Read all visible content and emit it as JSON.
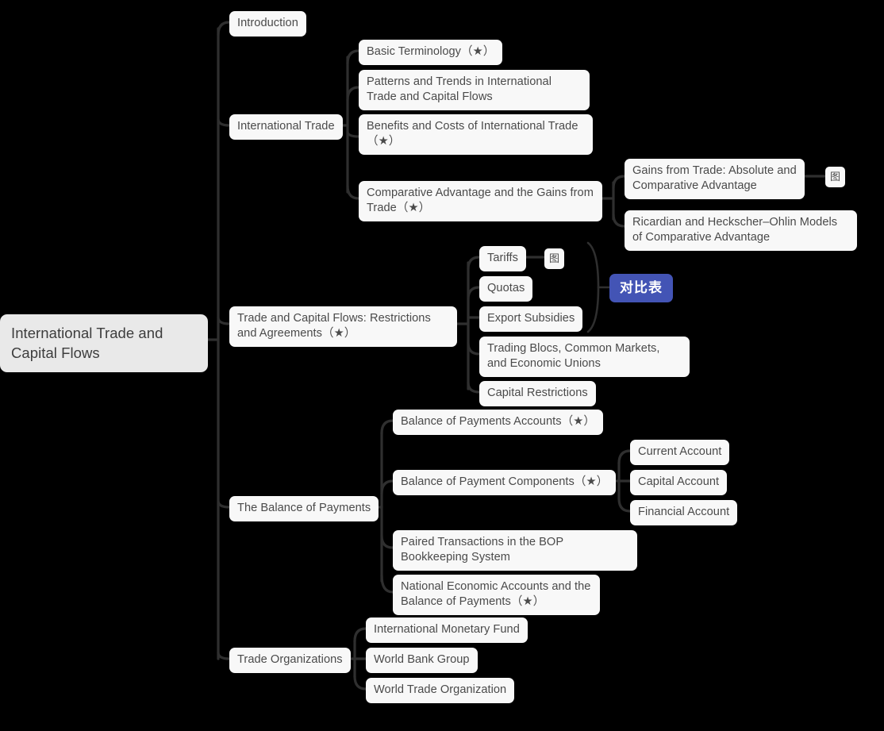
{
  "diagram": {
    "type": "mindmap",
    "background_color": "#000000",
    "node_color": "#f8f8f8",
    "root_color": "#e9e9e9",
    "accent_color": "#4354b5",
    "text_color": "#4a4a4a",
    "edge_color": "#2f2f2f"
  },
  "root": {
    "label": "International Trade and Capital Flows"
  },
  "branches": {
    "introduction": {
      "label": "Introduction"
    },
    "international_trade": {
      "label": "International Trade",
      "children": {
        "basic_terminology": {
          "label": "Basic Terminology（★）"
        },
        "patterns_trends": {
          "label": "Patterns and Trends in International Trade and Capital Flows"
        },
        "benefits_costs": {
          "label": "Benefits and Costs of International Trade（★）"
        },
        "comparative_advantage": {
          "label": "Comparative Advantage and the Gains from Trade（★）",
          "children": {
            "gains_from_trade": {
              "label": "Gains from Trade: Absolute and Comparative Advantage",
              "children": {
                "diagram_marker": {
                  "label": "图"
                }
              }
            },
            "ricardian": {
              "label": "Ricardian and Heckscher–Ohlin Models of Comparative Advantage"
            }
          }
        }
      }
    },
    "trade_capital_flows": {
      "label": "Trade and Capital Flows: Restrictions and Agreements（★）",
      "children": {
        "tariffs": {
          "label": "Tariffs",
          "children": {
            "diagram_marker": {
              "label": "图"
            }
          }
        },
        "quotas": {
          "label": "Quotas"
        },
        "export_subsidies": {
          "label": "Export Subsidies"
        },
        "trading_blocs": {
          "label": "Trading Blocs, Common Markets, and Economic Unions"
        },
        "capital_restrictions": {
          "label": "Capital Restrictions"
        }
      },
      "summary": {
        "label": "对比表",
        "covers": [
          "Tariffs",
          "Quotas",
          "Export Subsidies"
        ]
      }
    },
    "balance_of_payments": {
      "label": "The Balance of Payments",
      "children": {
        "bop_accounts": {
          "label": "Balance of Payments Accounts（★）"
        },
        "bop_components": {
          "label": "Balance of Payment Components（★）",
          "children": {
            "current_account": {
              "label": "Current Account"
            },
            "capital_account": {
              "label": "Capital Account"
            },
            "financial_account": {
              "label": "Financial Account"
            }
          }
        },
        "paired_transactions": {
          "label": "Paired Transactions in the BOP Bookkeeping System"
        },
        "national_economic_accounts": {
          "label": "National Economic Accounts and the Balance of Payments（★）"
        }
      }
    },
    "trade_organizations": {
      "label": "Trade Organizations",
      "children": {
        "imf": {
          "label": "International Monetary Fund"
        },
        "world_bank": {
          "label": "World Bank Group"
        },
        "wto": {
          "label": "World Trade Organization"
        }
      }
    }
  }
}
